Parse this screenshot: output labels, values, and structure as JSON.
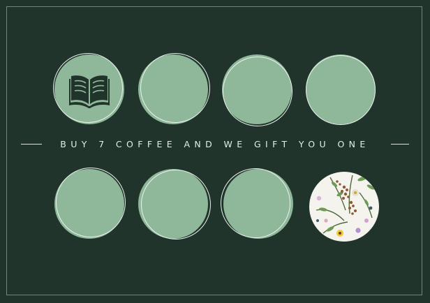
{
  "card": {
    "tagline": "BUY 7 COFFEE AND WE GIFT YOU ONE",
    "stamps": [
      {
        "slot": 1,
        "icon": "open-book-icon"
      },
      {
        "slot": 2
      },
      {
        "slot": 3
      },
      {
        "slot": 4
      },
      {
        "slot": 5
      },
      {
        "slot": 6
      },
      {
        "slot": 7
      },
      {
        "slot": 8,
        "image": "pressed-flowers-photo"
      }
    ],
    "colors": {
      "background": "#21342b",
      "stamp_fill": "#8fb89b",
      "ring": "#e9f2ec",
      "text": "#e3ece6"
    }
  }
}
